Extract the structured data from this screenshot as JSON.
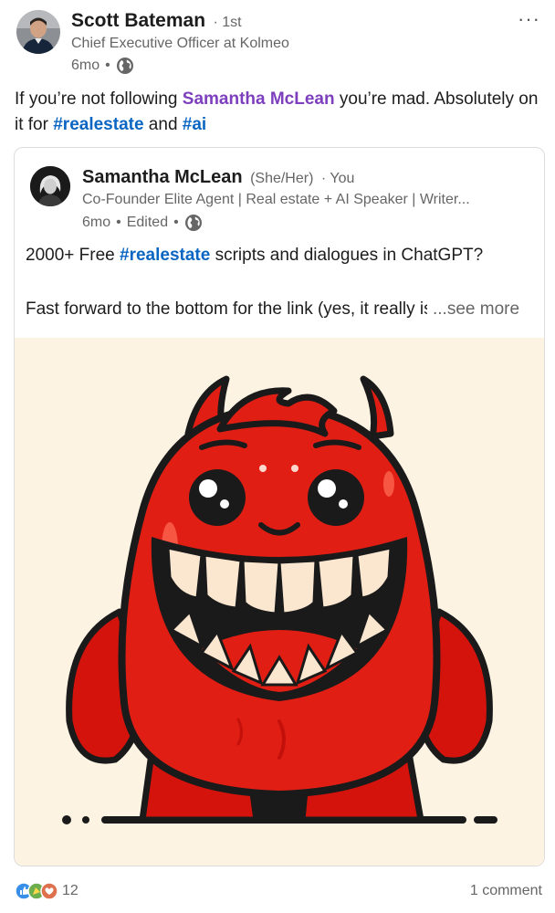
{
  "post": {
    "author": {
      "name": "Scott Bateman",
      "degree": "1st",
      "headline": "Chief Executive Officer at Kolmeo",
      "time": "6mo",
      "visibility_icon": "globe-icon"
    },
    "more_icon": "more-horizontal-icon",
    "more_label": "···",
    "text": {
      "part1": "If you’re not following ",
      "mention": "Samantha McLean",
      "part2": " you’re mad. Absolutely on it for ",
      "hashtag1": "#realestate",
      "part3": " and ",
      "hashtag2": "#ai"
    }
  },
  "shared": {
    "author": {
      "name": "Samantha McLean",
      "pronouns": "(She/Her)",
      "degree": "You",
      "headline": "Co-Founder Elite Agent | Real estate + AI Speaker | Writer...",
      "time": "6mo",
      "edited": "Edited",
      "visibility_icon": "globe-icon"
    },
    "text1_part1": "2000+ Free ",
    "text1_hashtag": "#realestate",
    "text1_part2": " scripts and dialogues in ChatGPT?",
    "text2": "Fast forward to the bottom for the link (yes, it really is free)",
    "see_more": "...see more",
    "image": "red-monster-illustration"
  },
  "footer": {
    "reaction_icons": [
      "like-icon",
      "celebrate-icon",
      "love-icon"
    ],
    "reaction_count": "12",
    "comments": "1 comment"
  },
  "colors": {
    "mention": "#7e3fbf",
    "hashtag": "#0a66c2",
    "monster_red": "#e01e14",
    "image_bg": "#fdf3e3"
  }
}
